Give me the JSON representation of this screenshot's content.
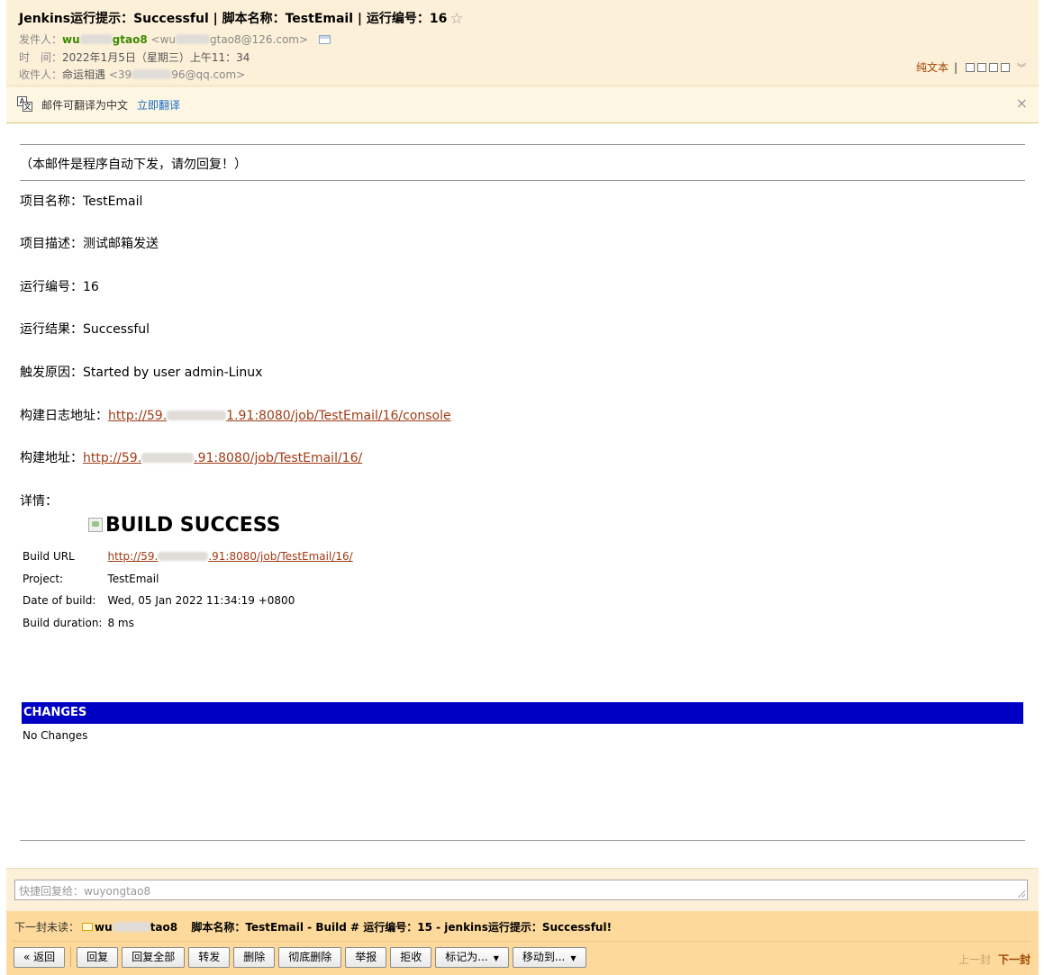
{
  "header": {
    "subject": "Jenkins运行提示：Successful | 脚本名称：TestEmail | 运行编号：16",
    "star_icon": "☆",
    "from_label": "发件人：",
    "from_name_a": "wu",
    "from_name_b": "gtao8",
    "from_email_a": "<wu",
    "from_email_b": "gtao8@126.com>",
    "time_label": "时　间：",
    "time_value": "2022年1月5日（星期三）上午11：34",
    "to_label": "收件人：",
    "to_name": "命运相遇",
    "to_email_a": "<39",
    "to_email_b": "96@qq.com>",
    "plain_text": "纯文本",
    "divider": "|"
  },
  "translate": {
    "text": "邮件可翻译为中文",
    "link": "立即翻译",
    "close": "×"
  },
  "body": {
    "notice": "（本邮件是程序自动下发，请勿回复！）",
    "fields": [
      {
        "label": "项目名称：",
        "value": "TestEmail"
      },
      {
        "label": "项目描述：",
        "value": "测试邮箱发送"
      },
      {
        "label": "运行编号：",
        "value": "16"
      },
      {
        "label": "运行结果：",
        "value": "Successful"
      },
      {
        "label": "触发原因：",
        "value": "Started by user admin-Linux"
      }
    ],
    "log_label": "构建日志地址：",
    "log_url_a": "http://59.",
    "log_url_b": "1.91:8080/job/TestEmail/16/console",
    "build_label": "构建地址：",
    "build_url_a": "http://59.",
    "build_url_b": ".91:8080/job/TestEmail/16/",
    "details_label": "详情："
  },
  "build": {
    "title": "BUILD SUCCESS",
    "rows": [
      {
        "key": "Build URL",
        "value_a": "http://59.",
        "value_b": ".91:8080/job/TestEmail/16/"
      },
      {
        "key": "Project:",
        "value": "TestEmail"
      },
      {
        "key": "Date of build:",
        "value": "Wed, 05 Jan 2022 11:34:19 +0800"
      },
      {
        "key": "Build duration:",
        "value": "8 ms"
      }
    ]
  },
  "changes": {
    "header": "CHANGES",
    "text": "No Changes"
  },
  "reply": {
    "placeholder": "快捷回复给：wuyongtao8"
  },
  "next": {
    "label": "下一封未读：",
    "sender_a": "wu",
    "sender_b": "tao8",
    "subject": "脚本名称：TestEmail - Build # 运行编号：15 - jenkins运行提示：Successful!"
  },
  "toolbar": {
    "back": "« 返回",
    "reply": "回复",
    "reply_all": "回复全部",
    "forward": "转发",
    "delete": "删除",
    "delete_perm": "彻底删除",
    "report": "举报",
    "reject": "拒收",
    "mark_as": "标记为...",
    "move_to": "移动到...",
    "prev": "上一封",
    "next": "下一封"
  }
}
